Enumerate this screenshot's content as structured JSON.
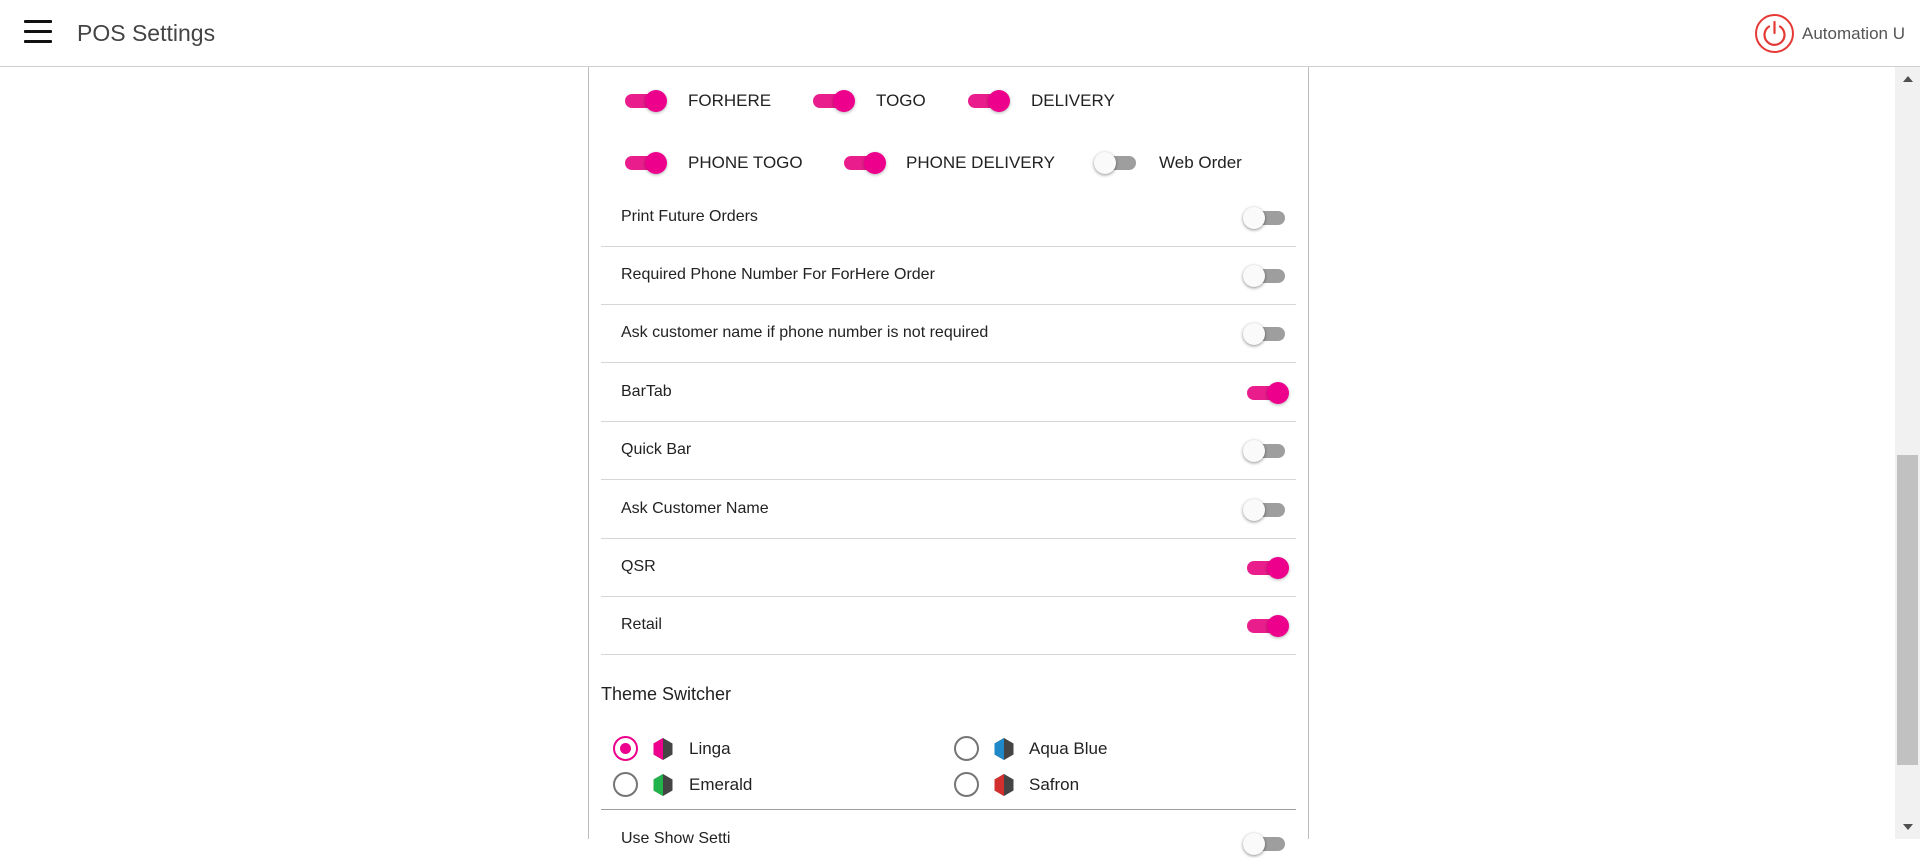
{
  "header": {
    "title": "POS Settings",
    "menu_icon": "hamburger-menu-icon",
    "power_icon": "power-icon",
    "user_name": "Automation U"
  },
  "order_types": [
    {
      "label": "FORHERE",
      "on": true
    },
    {
      "label": "TOGO",
      "on": true
    },
    {
      "label": "DELIVERY",
      "on": true
    },
    {
      "label": "PHONE TOGO",
      "on": true
    },
    {
      "label": "PHONE DELIVERY",
      "on": true
    },
    {
      "label": "Web Order",
      "on": false
    }
  ],
  "settings": [
    {
      "label": "Print Future Orders",
      "on": false
    },
    {
      "label": "Required Phone Number For ForHere Order",
      "on": false
    },
    {
      "label": "Ask customer name if phone number is not required",
      "on": false
    },
    {
      "label": "BarTab",
      "on": true
    },
    {
      "label": "Quick Bar",
      "on": false
    },
    {
      "label": "Ask Customer Name",
      "on": false
    },
    {
      "label": "QSR",
      "on": true
    },
    {
      "label": "Retail",
      "on": true
    }
  ],
  "theme_switcher": {
    "title": "Theme Switcher",
    "options": [
      {
        "label": "Linga",
        "selected": true,
        "color": "#ec008c"
      },
      {
        "label": "Aqua Blue",
        "selected": false,
        "color": "#1e88c8"
      },
      {
        "label": "Emerald",
        "selected": false,
        "color": "#22b24c"
      },
      {
        "label": "Safron",
        "selected": false,
        "color": "#d32f2f"
      }
    ]
  },
  "partial_setting": {
    "label": "Use Show Setti",
    "on": false
  },
  "colors": {
    "accent": "#ec008c",
    "toggle_off": "#9e9e9e",
    "power": "#e53935"
  }
}
